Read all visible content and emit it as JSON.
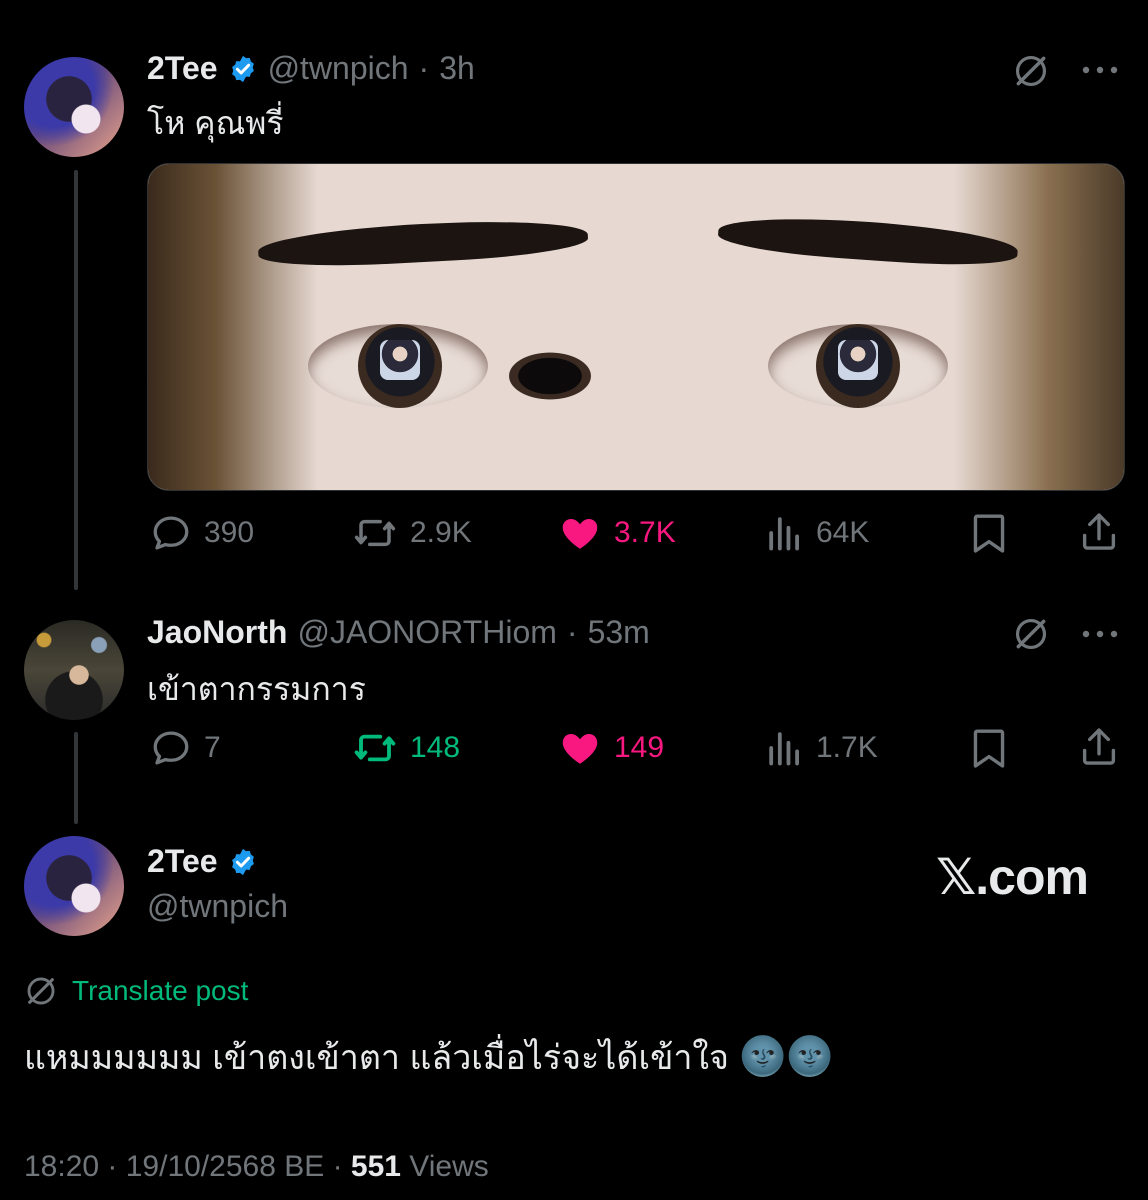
{
  "tweet1": {
    "name": "2Tee",
    "verified": true,
    "handle": "@twnpich",
    "time": "3h",
    "text": "โห คุณพรี่",
    "stats": {
      "replies": "390",
      "reposts": "2.9K",
      "likes": "3.7K",
      "views": "64K"
    }
  },
  "tweet2": {
    "name": "JaoNorth",
    "handle": "@JAONORTHiom",
    "time": "53m",
    "text": "เข้าตากรรมการ",
    "stats": {
      "replies": "7",
      "reposts": "148",
      "likes": "149",
      "views": "1.7K"
    }
  },
  "main": {
    "name": "2Tee",
    "verified": true,
    "handle": "@twnpich",
    "brand": "𝕏.com",
    "translate_label": "Translate post",
    "text": "แหมมมมมม เข้าตงเข้าตา แล้วเมื่อไร่จะได้เข้าใจ",
    "emoji": "🌚🌚",
    "timestamp": "18:20 · 19/10/2568 BE · ",
    "views_count": "551",
    "views_label": " Views"
  },
  "colors": {
    "background": "#000000",
    "text": "#e7e9ea",
    "muted": "#71767b",
    "like": "#f91880",
    "repost": "#00ba7c",
    "verified": "#1d9bf0",
    "translate": "#00ba7c"
  },
  "icons": [
    "reply-icon",
    "repost-icon",
    "like-icon",
    "views-icon",
    "bookmark-icon",
    "share-icon",
    "grok-icon",
    "more-icon",
    "verified-badge-icon",
    "translate-icon"
  ]
}
